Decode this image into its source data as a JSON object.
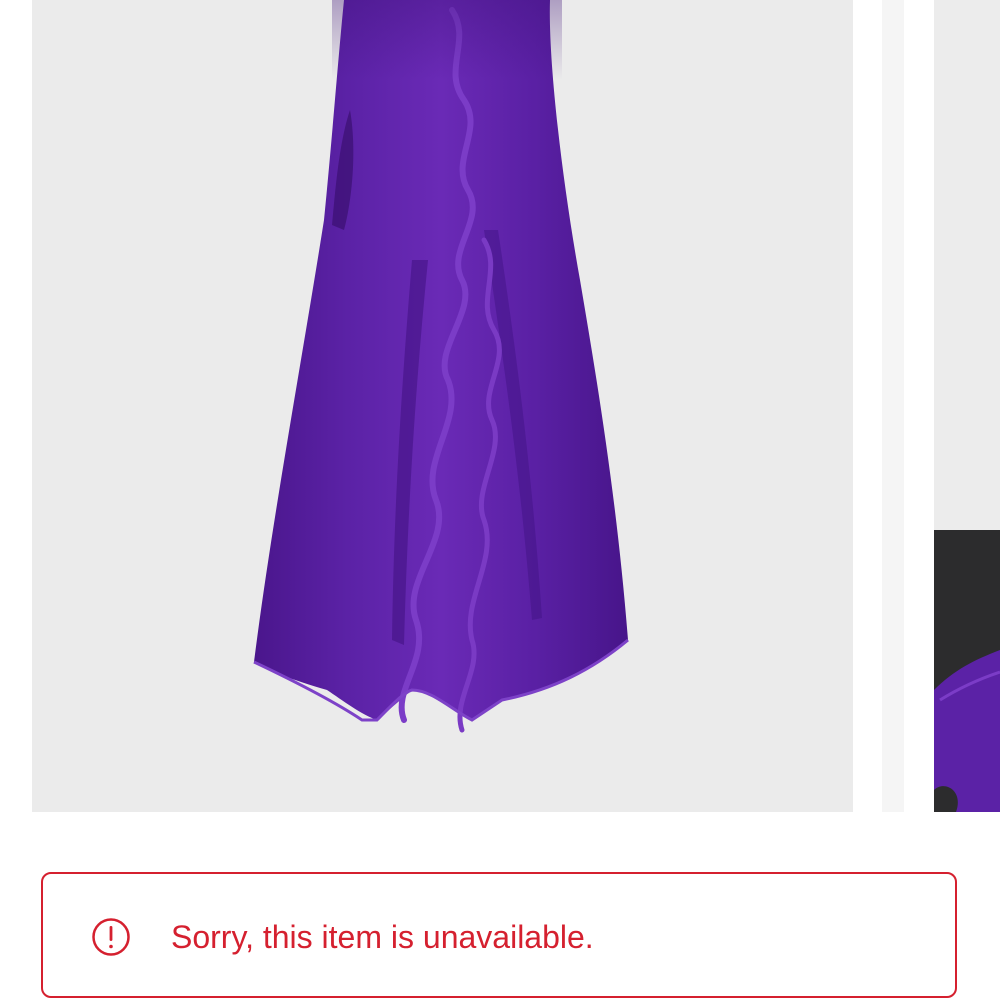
{
  "product_gallery": {
    "main_image": {
      "subject": "purple chiffon maxi dress with ruffle trim",
      "background_color": "#ebebeb",
      "dress_color": "#5a1fa3"
    },
    "next_image_peek": {
      "background_color": "#ececec",
      "band_color": "#2c2c2d"
    }
  },
  "availability_alert": {
    "icon": "exclamation-circle-icon",
    "message": "Sorry, this item is unavailable.",
    "accent_color": "#d5202f"
  }
}
